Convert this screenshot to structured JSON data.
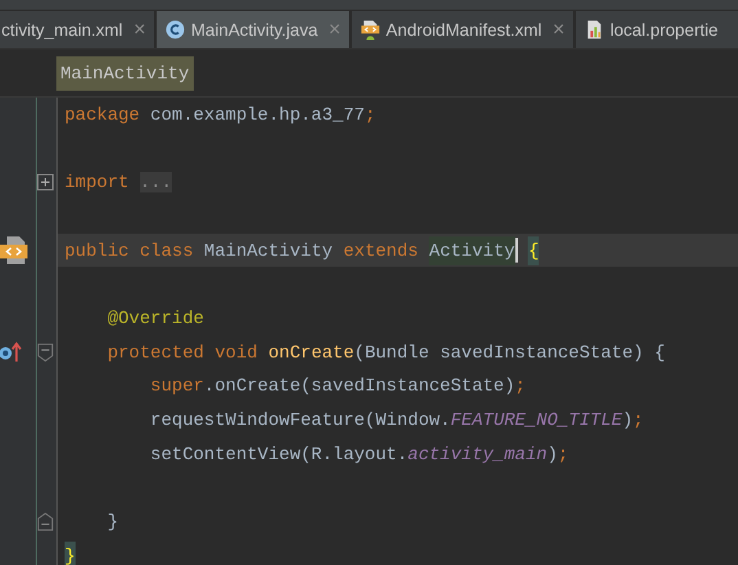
{
  "tabs": [
    {
      "label": "ctivity_main.xml",
      "selected": false,
      "closable": true
    },
    {
      "label": "MainActivity.java",
      "selected": true,
      "closable": true
    },
    {
      "label": "AndroidManifest.xml",
      "selected": false,
      "closable": true
    },
    {
      "label": "local.propertie",
      "selected": false,
      "closable": false
    }
  ],
  "close_glyph": "×",
  "breadcrumb": "MainActivity",
  "lines": [
    {
      "current": false,
      "tokens": [
        {
          "text": "package",
          "kind": "keyword"
        },
        {
          "text": " com.example.hp.a3_77",
          "kind": "plain"
        },
        {
          "text": ";",
          "kind": "punct"
        }
      ]
    },
    {
      "current": false
    },
    {
      "current": false,
      "tokens": [
        {
          "text": "import",
          "kind": "keyword"
        },
        {
          "text": "...",
          "kind": "folded"
        }
      ]
    },
    {
      "current": false
    },
    {
      "current": true,
      "tokens": [
        {
          "text": "public class",
          "kind": "keyword"
        },
        {
          "text": " MainActivity ",
          "kind": "plain"
        },
        {
          "text": "extends ",
          "kind": "keyword"
        },
        {
          "text": "Activity",
          "kind": "identifier-match"
        },
        {
          "text": "{",
          "kind": "brace-match"
        }
      ]
    },
    {
      "current": false
    },
    {
      "current": false,
      "tokens": [
        {
          "text": "    @Override",
          "kind": "annotation"
        }
      ]
    },
    {
      "current": false,
      "tokens": [
        {
          "text": "    protected void ",
          "kind": "keyword"
        },
        {
          "text": "onCreate",
          "kind": "method"
        },
        {
          "text": "(Bundle savedInstanceState) {",
          "kind": "plain"
        }
      ]
    },
    {
      "current": false,
      "tokens": [
        {
          "text": "        super",
          "kind": "keyword"
        },
        {
          "text": ".onCreate(savedInstanceState)",
          "kind": "plain"
        },
        {
          "text": ";",
          "kind": "punct"
        }
      ]
    },
    {
      "current": false,
      "tokens": [
        {
          "text": "        requestWindowFeature(Window.",
          "kind": "plain"
        },
        {
          "text": "FEATURE_NO_TITLE",
          "kind": "constant"
        },
        {
          "text": ")",
          "kind": "plain"
        },
        {
          "text": ";",
          "kind": "punct"
        }
      ]
    },
    {
      "current": false,
      "tokens": [
        {
          "text": "        setContentView(R.layout.",
          "kind": "plain"
        },
        {
          "text": "activity_main",
          "kind": "constant"
        },
        {
          "text": ")",
          "kind": "plain"
        },
        {
          "text": ";",
          "kind": "punct"
        }
      ]
    },
    {
      "current": false
    },
    {
      "current": false,
      "tokens": [
        {
          "text": "    }",
          "kind": "plain"
        }
      ]
    },
    {
      "current": false,
      "tokens": [
        {
          "text": "}",
          "kind": "brace-match-end"
        }
      ]
    }
  ]
}
